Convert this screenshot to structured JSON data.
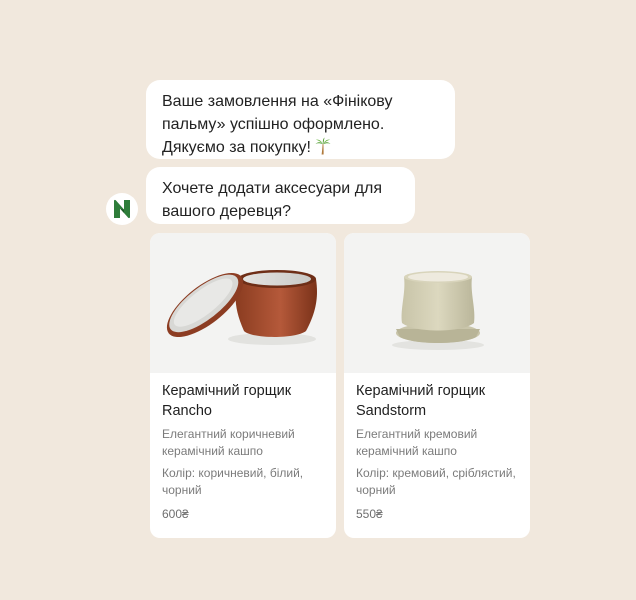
{
  "chat": {
    "messages": [
      {
        "text": "Ваше замовлення на «Фінікову пальму» успішно оформлено. Дякуємо за покупку!",
        "emoji": "palm-tree-icon"
      },
      {
        "text": "Хочете додати аксесуари для вашого деревця?"
      }
    ],
    "avatar": {
      "icon": "brand-logo-icon",
      "color": "#2e7d3a"
    }
  },
  "products": [
    {
      "title": "Керамічний горщик Rancho",
      "description": "Елегантний коричневий керамічний кашпо",
      "colors": "Колір: коричневий, білий, чорний",
      "price": "600₴",
      "image": "terracotta-pot-with-saucer"
    },
    {
      "title": "Керамічний горщик Sandstorm",
      "description": "Елегантний кремовий керамічний кашпо",
      "colors": "Колір: кремовий, сріблястий, чорний",
      "price": "550₴",
      "image": "cream-pot-with-saucer"
    }
  ],
  "colors": {
    "background": "#f1e8dd",
    "bubble": "#ffffff",
    "brand": "#2e7d3a"
  }
}
